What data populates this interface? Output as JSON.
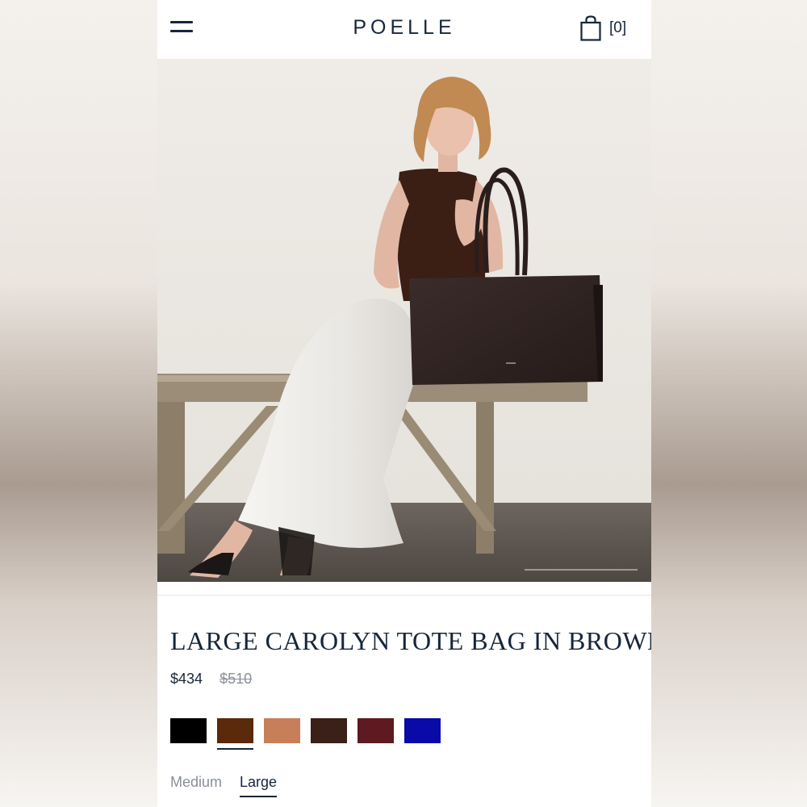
{
  "header": {
    "brand": "POELLE",
    "cart_count": "[0]",
    "menu_icon": "hamburger-menu-icon",
    "cart_icon": "shopping-bag-icon"
  },
  "hero": {
    "alt": "Model seated on wooden bench holding a large brown tote bag"
  },
  "product": {
    "title": "LARGE CAROLYN TOTE BAG IN BROWN",
    "price": "$434",
    "original_price": "$510",
    "colors": [
      {
        "color": "#000000",
        "selected": false
      },
      {
        "color": "#5a2a0a",
        "selected": true
      },
      {
        "color": "#c77f5a",
        "selected": false
      },
      {
        "color": "#3a2018",
        "selected": false
      },
      {
        "color": "#5e1a20",
        "selected": false
      },
      {
        "color": "#0a0aa8",
        "selected": false
      }
    ],
    "sizes": [
      {
        "label": "Medium",
        "active": false
      },
      {
        "label": "Large",
        "active": true
      }
    ]
  },
  "theme": {
    "text": "#16263a",
    "muted": "#8a8f98"
  }
}
